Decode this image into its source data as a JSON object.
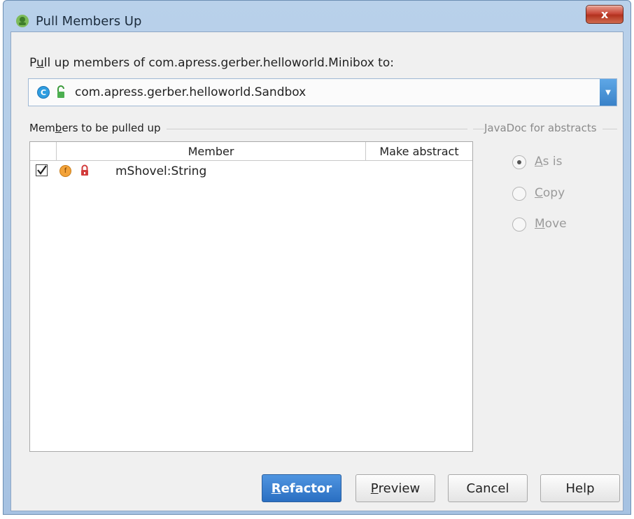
{
  "window": {
    "title": "Pull Members Up",
    "close_label": "x"
  },
  "dialog": {
    "pull_label_prefix": "P",
    "pull_label_underlined": "u",
    "pull_label_rest": "ll up members of com.apress.gerber.helloworld.Minibox to:",
    "target_class_icon": "C",
    "target_class": "com.apress.gerber.helloworld.Sandbox",
    "members_section_prefix": "Mem",
    "members_section_underlined": "b",
    "members_section_rest": "ers to be pulled up",
    "javadoc_section": "JavaDoc for abstracts"
  },
  "table": {
    "columns": [
      "Member",
      "Make abstract"
    ],
    "rows": [
      {
        "checked": true,
        "field_icon": "f",
        "name": "mShovel:String",
        "make_abstract": ""
      }
    ]
  },
  "javadoc_options": [
    {
      "underlined": "A",
      "rest": "s is",
      "selected": true
    },
    {
      "underlined": "C",
      "rest": "opy",
      "selected": false
    },
    {
      "underlined": "M",
      "rest": "ove",
      "selected": false
    }
  ],
  "buttons": {
    "refactor": {
      "underlined": "R",
      "rest": "efactor"
    },
    "preview": {
      "underlined": "P",
      "rest": "review"
    },
    "cancel": "Cancel",
    "help": "Help"
  },
  "colors": {
    "title_bar": "#b9d1ea",
    "primary_button": "#2a6fc2",
    "close_button": "#c9493a"
  }
}
